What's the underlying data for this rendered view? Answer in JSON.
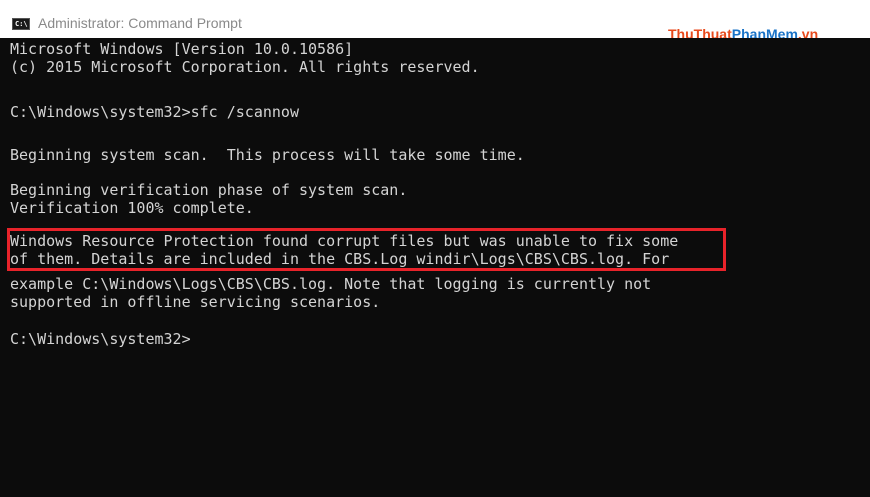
{
  "window": {
    "title": "Administrator: Command Prompt",
    "icon": "cmd-icon",
    "icon_label": "C:\\"
  },
  "watermark": {
    "part1": "ThuThuat",
    "part2": "PhanMem",
    "part3": ".vn"
  },
  "console": {
    "lines": [
      "Microsoft Windows [Version 10.0.10586]",
      "(c) 2015 Microsoft Corporation. All rights reserved.",
      "",
      "C:\\Windows\\system32>sfc /scannow",
      "",
      "Beginning system scan.  This process will take some time.",
      "",
      "Beginning verification phase of system scan.",
      "Verification 100% complete.",
      "",
      "Windows Resource Protection found corrupt files but was unable to fix some",
      "of them. Details are included in the CBS.Log windir\\Logs\\CBS\\CBS.log. For",
      "example C:\\Windows\\Logs\\CBS\\CBS.log. Note that logging is currently not",
      "supported in offline servicing scenarios.",
      "",
      "C:\\Windows\\system32>"
    ]
  },
  "colors": {
    "console_bg": "#0c0c0c",
    "console_text": "#d4d4d4",
    "highlight_border": "#e8232a"
  }
}
